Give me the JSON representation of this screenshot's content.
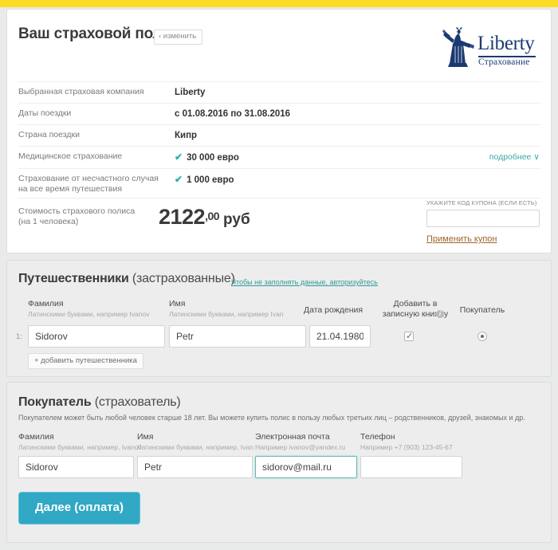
{
  "accent": {
    "top_bar": "#fbdd25",
    "teal": "#31a8c4",
    "check_teal": "#28b3ad",
    "coupon_link": "#a0632c",
    "logo_navy": "#1c3a72"
  },
  "policy": {
    "title": "Ваш страховой полис",
    "change_button": "‹ изменить",
    "logo": {
      "wordmark": "Liberty",
      "sub": "Страхование",
      "icon": "statue-of-liberty-icon"
    },
    "rows": [
      {
        "label": "Выбранная страховая компания",
        "value": "Liberty",
        "check": false
      },
      {
        "label": "Даты поездки",
        "value": "с 01.08.2016 по 31.08.2016",
        "check": false
      },
      {
        "label": "Страна поездки",
        "value": "Кипр",
        "check": false
      },
      {
        "label": "Медицинское страхование",
        "value": "30 000 евро",
        "check": true,
        "more": "подробнее ∨"
      },
      {
        "label": "Страхование от несчастного случая на все время путешествия",
        "value": "1 000 евро",
        "check": true
      }
    ],
    "price": {
      "label": "Стоимость страхового полиса (на 1 человека)",
      "label_line1": "Стоимость страхового полиса",
      "label_line2": "(на 1 человека)",
      "integer": "2122",
      "decimal": ",00",
      "currency": "руб"
    },
    "coupon": {
      "caption": "Укажите код купона (если есть)",
      "value": "",
      "placeholder": "",
      "apply_link": "Применить купон"
    }
  },
  "travelers": {
    "title_bold": "Путешественники",
    "title_light": " (застрахованные)",
    "auth_link": "Чтобы не заполнять данные, авторизуйтесь",
    "columns": [
      {
        "title": "Фамилия",
        "hint": "Латинскими буквами, например Ivanov"
      },
      {
        "title": "Имя",
        "hint": "Латинскими буквами, например Ivan"
      },
      {
        "title": "Дата рождения",
        "hint": ""
      },
      {
        "title_line1": "Добавить в",
        "title_line2": "записную книжку",
        "hint": ""
      },
      {
        "title": "Покупатель",
        "hint": ""
      }
    ],
    "rows": [
      {
        "index": "1:",
        "surname": "Sidorov",
        "name": "Petr",
        "birthdate": "21.04.1980",
        "address_book_checked": true,
        "is_buyer_selected": true
      }
    ],
    "add_button": "+ добавить путешественника"
  },
  "buyer": {
    "title_bold": "Покупатель",
    "title_light": " (страхователь)",
    "description": "Покупателем может быть любой человек старше 18 лет. Вы можете купить полис в пользу любых третьих лиц – родственников, друзей, знакомых и др.",
    "fields": [
      {
        "title": "Фамилия",
        "hint": "Латинскими буквами, например, Ivanov",
        "value": "Sidorov",
        "focused": false
      },
      {
        "title": "Имя",
        "hint": "Латинскими буквами, например, Ivan",
        "value": "Petr",
        "focused": false
      },
      {
        "title": "Электронная почта",
        "hint": "Например ivanov@yandex.ru",
        "value": "sidorov@mail.ru",
        "focused": true
      },
      {
        "title": "Телефон",
        "hint": "Например +7 (903) 123-45-67",
        "value": "",
        "focused": false
      }
    ],
    "submit_button": "Далее (оплата)"
  }
}
